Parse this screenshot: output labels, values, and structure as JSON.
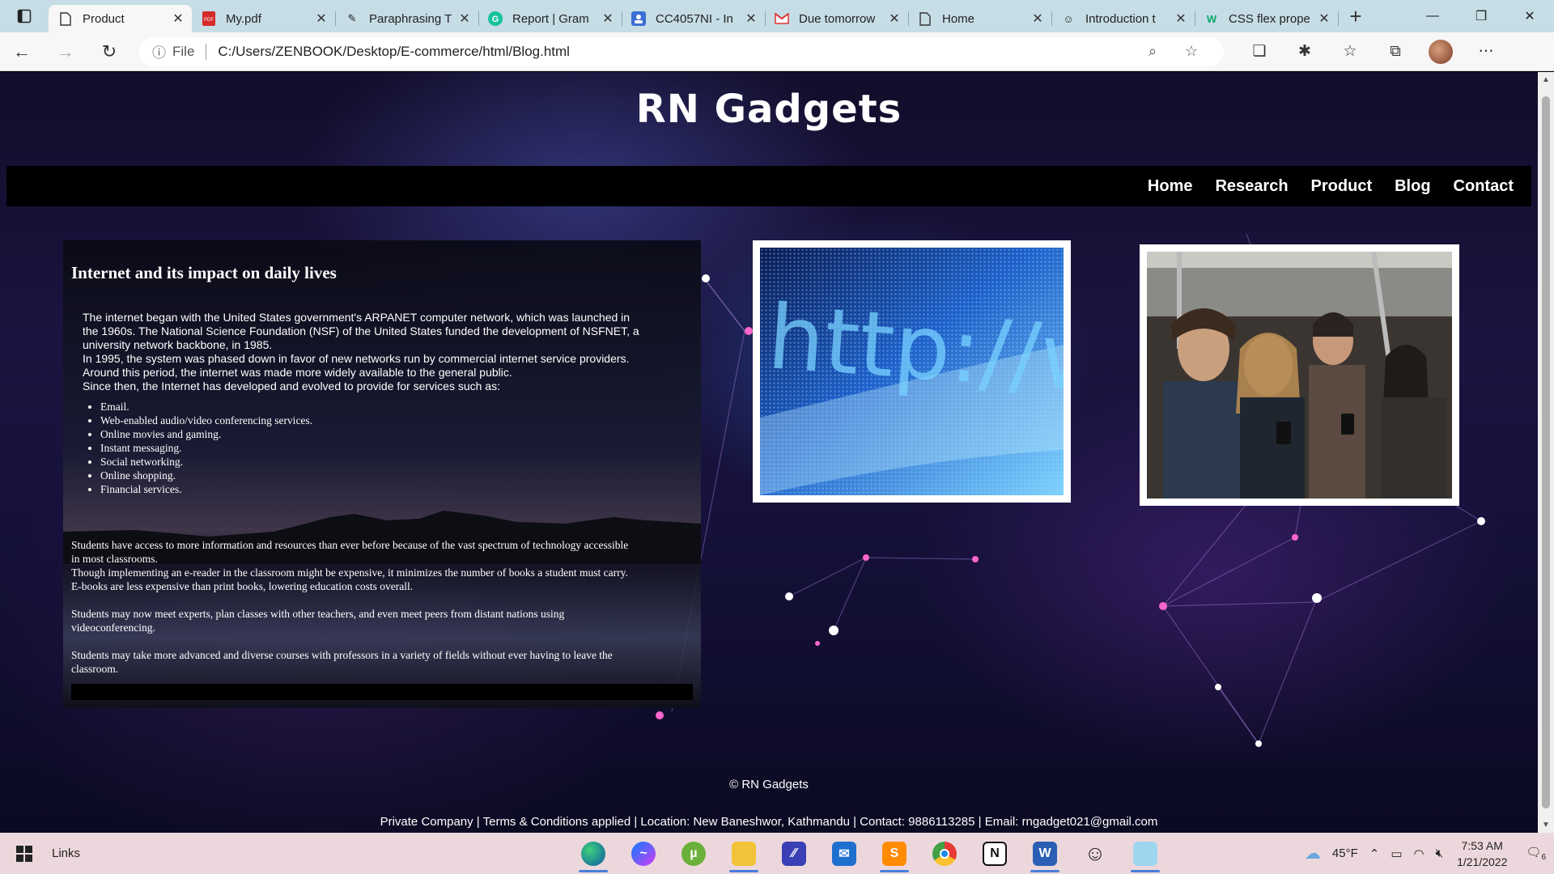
{
  "browser": {
    "tabs": [
      {
        "title": "Product",
        "icon": "page-icon",
        "active": true
      },
      {
        "title": "My.pdf",
        "icon": "pdf-icon"
      },
      {
        "title": "Paraphrasing T",
        "icon": "quill-icon"
      },
      {
        "title": "Report | Gram",
        "icon": "grammarly-icon"
      },
      {
        "title": "CC4057NI - In",
        "icon": "teams-icon"
      },
      {
        "title": "Due tomorrow",
        "icon": "gmail-icon"
      },
      {
        "title": "Home",
        "icon": "page-icon"
      },
      {
        "title": "Introduction t",
        "icon": "smiley-icon"
      },
      {
        "title": "CSS flex prope",
        "icon": "w3schools-icon"
      }
    ],
    "address": {
      "scheme_label": "File",
      "url": "C:/Users/ZENBOOK/Desktop/E-commerce/html/Blog.html"
    }
  },
  "site": {
    "title": "RN Gadgets",
    "nav": [
      "Home",
      "Research",
      "Product",
      "Blog",
      "Contact"
    ]
  },
  "article": {
    "heading": "Internet and its impact on daily lives",
    "intro_lines": [
      "The internet began with the United States government's ARPANET computer network, which was launched in",
      "the 1960s. The National Science Foundation (NSF) of the United States funded the development of NSFNET, a",
      "university network backbone, in 1985.",
      "In 1995, the system was phased down in favor of new networks run by commercial internet service providers.",
      "Around this period, the internet was made more widely available to the general public.",
      "Since then, the Internet has developed and evolved to provide for services such as:"
    ],
    "services": [
      "Email.",
      "Web-enabled audio/video conferencing services.",
      "Online movies and gaming.",
      "Instant messaging.",
      "Social networking.",
      "Online shopping.",
      "Financial services."
    ],
    "para1_lines": [
      "Students have access to more information and resources than ever before because of the vast spectrum of technology accessible",
      "in most classrooms.",
      "Though implementing an e-reader in the classroom might be expensive, it minimizes the number of books a student must carry.",
      "E-books are less expensive than print books, lowering education costs overall."
    ],
    "para2_lines": [
      "Students may now meet experts, plan classes with other teachers, and even meet peers from distant nations using",
      "videoconferencing."
    ],
    "para3_lines": [
      "Students may take more advanced and diverse courses with professors in a variety of fields without ever having to leave the",
      "classroom."
    ]
  },
  "images": [
    {
      "subject": "http://www screen close-up",
      "text": "http://www."
    },
    {
      "subject": "commuters using phones on a train"
    }
  ],
  "footer": {
    "copyright": "© RN Gadgets",
    "info": "Private Company | Terms & Conditions applied | Location: New Baneshwor, Kathmandu | Contact: 9886113285 | Email: rngadget021@gmail.com"
  },
  "taskbar": {
    "links_label": "Links",
    "weather": "45°F",
    "time": "7:53 AM",
    "date": "1/21/2022",
    "notifications": "6",
    "apps": [
      "edge-icon",
      "messenger-icon",
      "utorrent-icon",
      "file-explorer-icon",
      "visual-studio-icon",
      "mail-icon",
      "sublime-text-icon",
      "chrome-icon",
      "notion-icon",
      "word-icon",
      "smiley-app-icon",
      "notepad-icon"
    ]
  }
}
